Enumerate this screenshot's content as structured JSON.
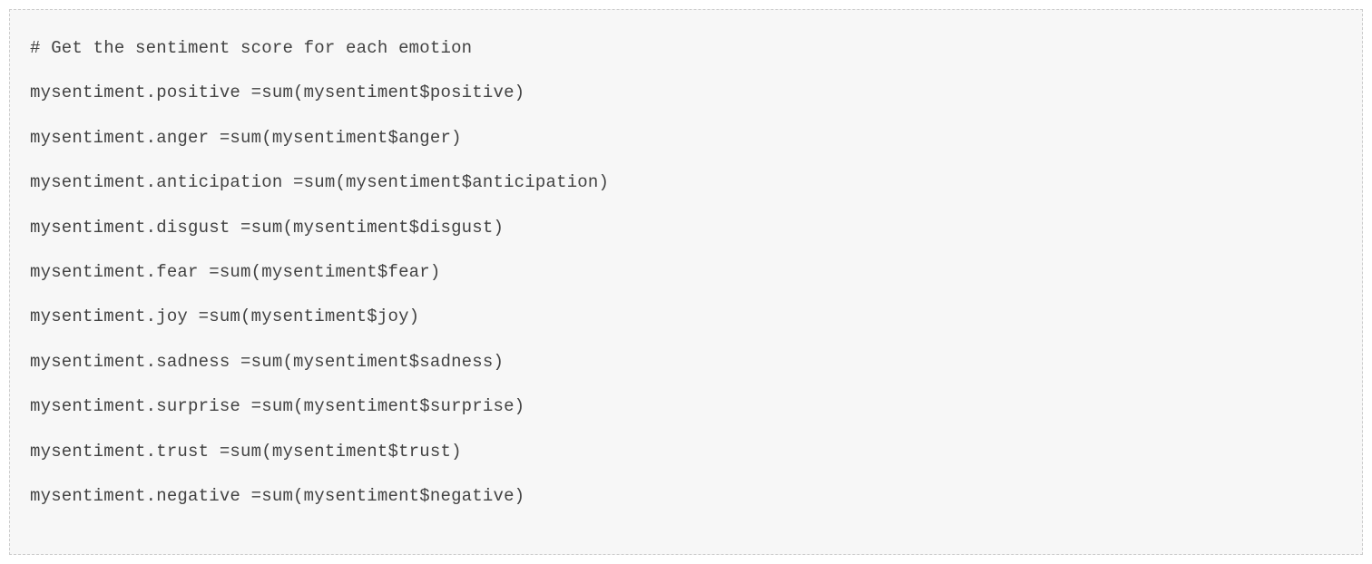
{
  "code": {
    "lines": [
      "# Get the sentiment score for each emotion",
      "mysentiment.positive =sum(mysentiment$positive)",
      "mysentiment.anger =sum(mysentiment$anger)",
      "mysentiment.anticipation =sum(mysentiment$anticipation)",
      "mysentiment.disgust =sum(mysentiment$disgust)",
      "mysentiment.fear =sum(mysentiment$fear)",
      "mysentiment.joy =sum(mysentiment$joy)",
      "mysentiment.sadness =sum(mysentiment$sadness)",
      "mysentiment.surprise =sum(mysentiment$surprise)",
      "mysentiment.trust =sum(mysentiment$trust)",
      "mysentiment.negative =sum(mysentiment$negative)"
    ]
  }
}
